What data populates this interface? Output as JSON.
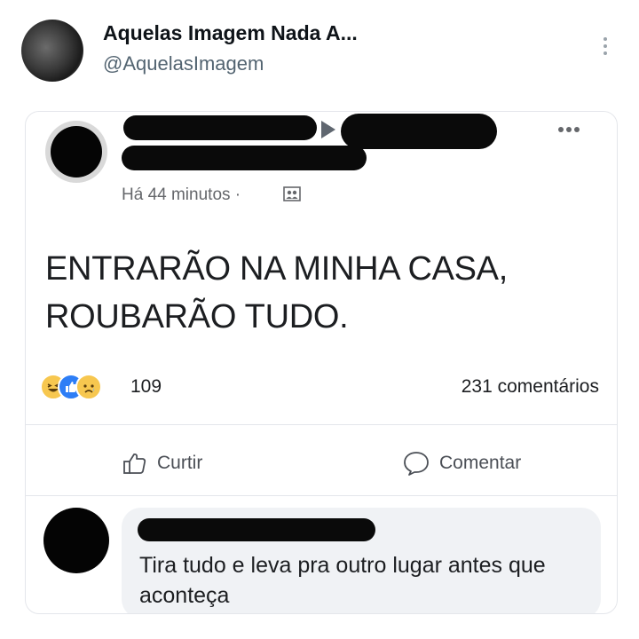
{
  "tweet": {
    "display_name": "Aquelas Imagem Nada A...",
    "handle": "@AquelasImagem",
    "more_icon": "kebab-vertical-icon"
  },
  "post": {
    "timestamp": "Há 44 minutos",
    "separator": "·",
    "audience_icon": "friends-audience-icon",
    "text_lines": [
      "ENTRARÃO NA MINHA CASA,",
      "ROUBARÃO TUDO."
    ],
    "reactions": [
      "haha-reaction-icon",
      "like-reaction-icon",
      "sad-reaction-icon"
    ],
    "reaction_count": "109",
    "comments_count": "231 comentários",
    "actions": {
      "like": "Curtir",
      "comment": "Comentar"
    }
  },
  "comment": {
    "text": "Tira tudo e leva pra outro lugar antes que aconteça"
  },
  "colors": {
    "text_primary": "#1c1e21",
    "text_secondary": "#65676b",
    "like_blue": "#2e7ef6",
    "reaction_yellow": "#f7c74f",
    "bubble_bg": "#f0f2f5",
    "redaction": "#0a0a0a"
  }
}
